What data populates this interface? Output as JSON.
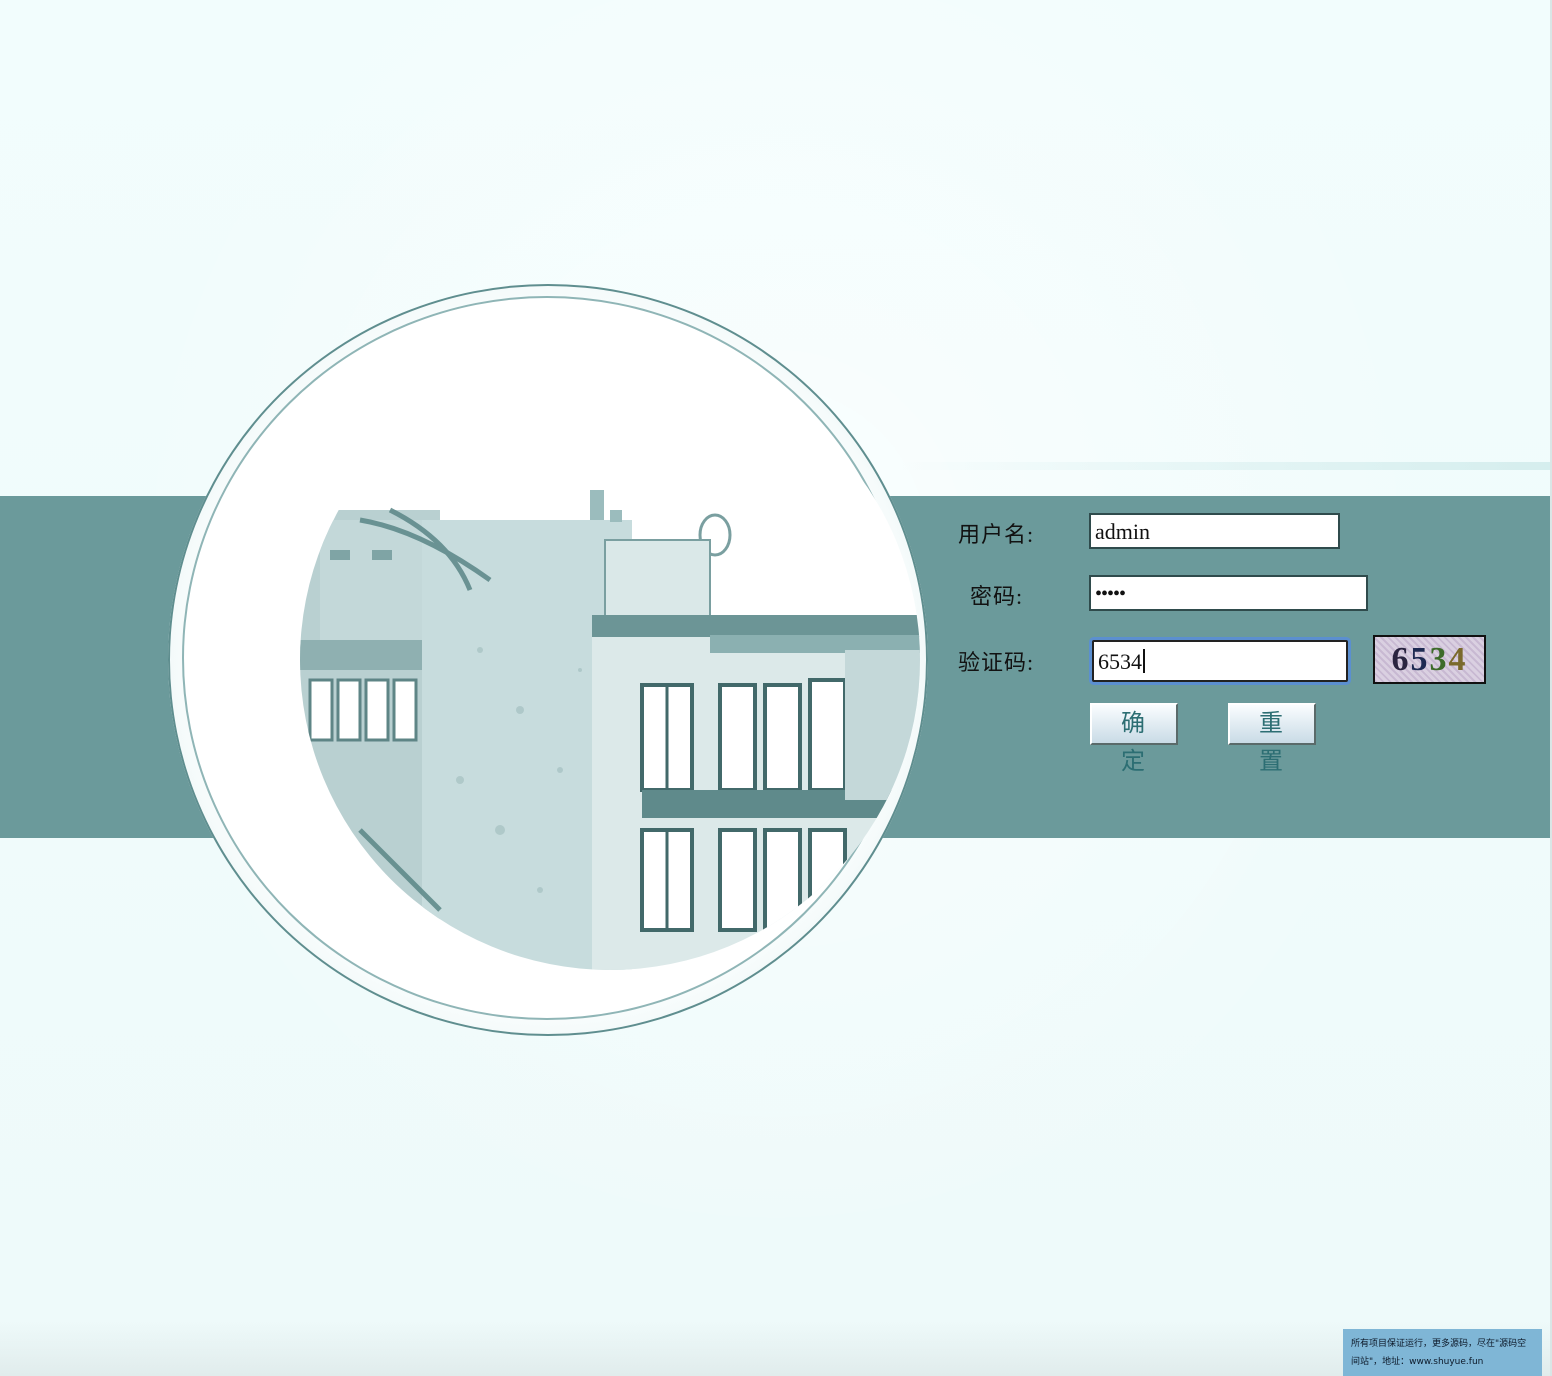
{
  "login_form": {
    "username_label": "用户名:",
    "password_label": "密码:",
    "captcha_label": "验证码:",
    "username_value": "admin",
    "password_value": "•••••",
    "captcha_value": "6534",
    "captcha_image": {
      "digits": [
        "6",
        "5",
        "3",
        "4"
      ],
      "digit_colors": [
        "#2a2440",
        "#1e2a52",
        "#3d6b2a",
        "#7a6a2c"
      ]
    },
    "submit_label": "确 定",
    "reset_label": "重 置"
  },
  "footer": {
    "notice_text": "所有项目保证运行，更多源码，尽在\"源码空间站\"，地址：www.shuyue.fun"
  },
  "colors": {
    "band": "#6b9a9b",
    "page_background": "#f0fcfc",
    "button_text": "#2c6e73",
    "notice_background": "#7fb6d6",
    "focus_ring": "#5b8fd0"
  }
}
